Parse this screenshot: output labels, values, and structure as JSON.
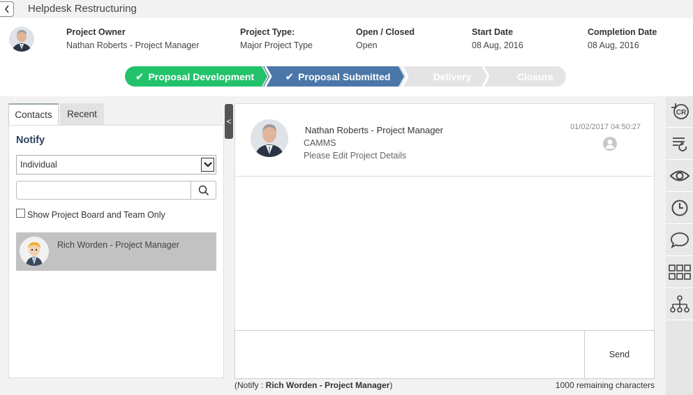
{
  "window": {
    "title": "Helpdesk Restructuring"
  },
  "header": {
    "owner_label": "Project Owner",
    "owner_value": "Nathan Roberts - Project Manager",
    "type_label": "Project Type:",
    "type_value": "Major Project Type",
    "status_label": "Open / Closed",
    "status_value": "Open",
    "start_label": "Start Date",
    "start_value": "08 Aug, 2016",
    "completion_label": "Completion Date",
    "completion_value": "08 Aug, 2016"
  },
  "stages": [
    {
      "label": "Proposal Development",
      "state": "complete",
      "color": "#22c26a"
    },
    {
      "label": "Proposal Submitted",
      "state": "current",
      "color": "#4a77a8"
    },
    {
      "label": "Delivery",
      "state": "pending",
      "color": "#e4e4e4"
    },
    {
      "label": "Closure",
      "state": "pending",
      "color": "#e4e4e4"
    }
  ],
  "left": {
    "tabs": [
      {
        "label": "Contacts"
      },
      {
        "label": "Recent"
      }
    ],
    "notify_label": "Notify",
    "select_value": "Individual",
    "search_placeholder": "",
    "checkbox_label": "Show Project Board and Team Only",
    "contacts": [
      {
        "name": "Rich Worden - Project Manager"
      }
    ]
  },
  "messages": [
    {
      "author": "Nathan Roberts - Project Manager",
      "company": "CAMMS",
      "text": "Please Edit Project Details",
      "timestamp": "01/02/2017 04:50:27"
    }
  ],
  "compose": {
    "send_label": "Send",
    "notify_prefix": "(Notify : ",
    "notify_name": "Rich Worden - Project Manager",
    "notify_suffix": ")",
    "remaining": "1000 remaining characters"
  },
  "sidebar_icons": [
    "change-request-icon",
    "refresh-list-icon",
    "eye-icon",
    "clock-icon",
    "chat-bubble-icon",
    "grid-icon",
    "hierarchy-icon"
  ],
  "sidebar_cr_text": "CR",
  "collapse_symbol": "<"
}
